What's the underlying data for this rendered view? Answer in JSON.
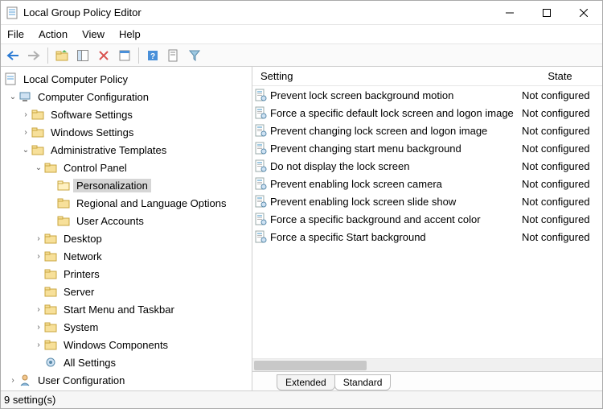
{
  "window": {
    "title": "Local Group Policy Editor"
  },
  "menu": {
    "file": "File",
    "action": "Action",
    "view": "View",
    "help": "Help"
  },
  "tree": {
    "root": "Local Computer Policy",
    "computer_config": "Computer Configuration",
    "software_settings": "Software Settings",
    "windows_settings": "Windows Settings",
    "admin_templates": "Administrative Templates",
    "control_panel": "Control Panel",
    "personalization": "Personalization",
    "regional": "Regional and Language Options",
    "user_accounts": "User Accounts",
    "desktop": "Desktop",
    "network": "Network",
    "printers": "Printers",
    "server": "Server",
    "startmenu": "Start Menu and Taskbar",
    "system": "System",
    "windows_components": "Windows Components",
    "all_settings": "All Settings",
    "user_config": "User Configuration"
  },
  "list": {
    "header_setting": "Setting",
    "header_state": "State",
    "items": [
      {
        "name": "Prevent lock screen background motion",
        "state": "Not configured"
      },
      {
        "name": "Force a specific default lock screen and logon image",
        "state": "Not configured"
      },
      {
        "name": "Prevent changing lock screen and logon image",
        "state": "Not configured"
      },
      {
        "name": "Prevent changing start menu background",
        "state": "Not configured"
      },
      {
        "name": "Do not display the lock screen",
        "state": "Not configured"
      },
      {
        "name": "Prevent enabling lock screen camera",
        "state": "Not configured"
      },
      {
        "name": "Prevent enabling lock screen slide show",
        "state": "Not configured"
      },
      {
        "name": "Force a specific background and accent color",
        "state": "Not configured"
      },
      {
        "name": "Force a specific Start background",
        "state": "Not configured"
      }
    ]
  },
  "tabs": {
    "extended": "Extended",
    "standard": "Standard"
  },
  "status": {
    "text": "9 setting(s)"
  }
}
